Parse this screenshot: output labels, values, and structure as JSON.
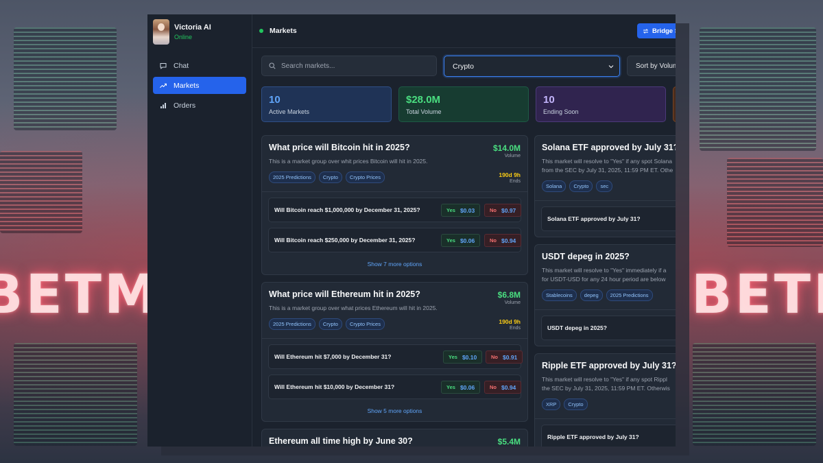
{
  "background": {
    "brand_text_left": "BETME",
    "brand_text_right": "BETME"
  },
  "sidebar": {
    "profile": {
      "name": "Victoria AI",
      "status": "Online"
    },
    "items": [
      {
        "label": "Chat",
        "icon": "chat-icon",
        "active": false
      },
      {
        "label": "Markets",
        "icon": "trending-up-icon",
        "active": true
      },
      {
        "label": "Orders",
        "icon": "bar-chart-icon",
        "active": false
      }
    ]
  },
  "header": {
    "title": "Markets",
    "bridge_label": "Bridge S"
  },
  "filters": {
    "search_placeholder": "Search markets...",
    "category": "Crypto",
    "sort": "Sort by Volum"
  },
  "stats": [
    {
      "value": "10",
      "label": "Active Markets"
    },
    {
      "value": "$28.0M",
      "label": "Total Volume"
    },
    {
      "value": "10",
      "label": "Ending Soon"
    }
  ],
  "markets_left": [
    {
      "title": "What price will Bitcoin hit in 2025?",
      "description": "This is a market group over whit prices Bitcoin will hit in 2025.",
      "volume": "$14.0M",
      "volume_label": "Volume",
      "ends": "190d 9h",
      "ends_label": "Ends",
      "tags": [
        "2025 Predictions",
        "Crypto",
        "Crypto Prices"
      ],
      "options": [
        {
          "question": "Will Bitcoin reach $1,000,000 by December 31, 2025?",
          "yes_label": "Yes",
          "yes_price": "$0.03",
          "no_label": "No",
          "no_price": "$0.97"
        },
        {
          "question": "Will Bitcoin reach $250,000 by December 31, 2025?",
          "yes_label": "Yes",
          "yes_price": "$0.06",
          "no_label": "No",
          "no_price": "$0.94"
        }
      ],
      "more": "Show 7 more options"
    },
    {
      "title": "What price will Ethereum hit in 2025?",
      "description": "This is a market group over what prices Ethereum will hit in 2025.",
      "volume": "$6.8M",
      "volume_label": "Volume",
      "ends": "190d 9h",
      "ends_label": "Ends",
      "tags": [
        "2025 Predictions",
        "Crypto",
        "Crypto Prices"
      ],
      "options": [
        {
          "question": "Will Ethereum hit $7,000 by December 31?",
          "yes_label": "Yes",
          "yes_price": "$0.10",
          "no_label": "No",
          "no_price": "$0.91"
        },
        {
          "question": "Will Ethereum hit $10,000 by December 31?",
          "yes_label": "Yes",
          "yes_price": "$0.06",
          "no_label": "No",
          "no_price": "$0.94"
        }
      ],
      "more": "Show 5 more options"
    },
    {
      "title": "Ethereum all time high by June 30?",
      "volume": "$5.4M"
    }
  ],
  "markets_right": [
    {
      "title": "Solana ETF approved by July 31?",
      "desc1": "This market will resolve to \"Yes\" if any spot Solana",
      "desc2": "from the SEC by July 31, 2025, 11:59 PM ET. Othe",
      "tags": [
        "Solana",
        "Crypto",
        "sec"
      ],
      "option": "Solana ETF approved by July 31?"
    },
    {
      "title": "USDT depeg in 2025?",
      "desc1": "This market will resolve to \"Yes\" immediately if a",
      "desc2": "for USDT-USD for any 24 hour period are below",
      "tags": [
        "Stablecoins",
        "depeg",
        "2025 Predictions"
      ],
      "option": "USDT depeg in 2025?"
    },
    {
      "title": "Ripple ETF approved by July 31?",
      "desc1": "This market will resolve to \"Yes\" if any spot Rippl",
      "desc2": "the SEC by July 31, 2025, 11:59 PM ET. Otherwis",
      "tags": [
        "XRP",
        "Crypto"
      ],
      "option": "Ripple ETF approved by July 31?"
    }
  ],
  "colors": {
    "accent": "#2563eb",
    "positive": "#4ade80",
    "negative": "#f87171",
    "warning": "#facc15",
    "background": "#1b222d"
  }
}
